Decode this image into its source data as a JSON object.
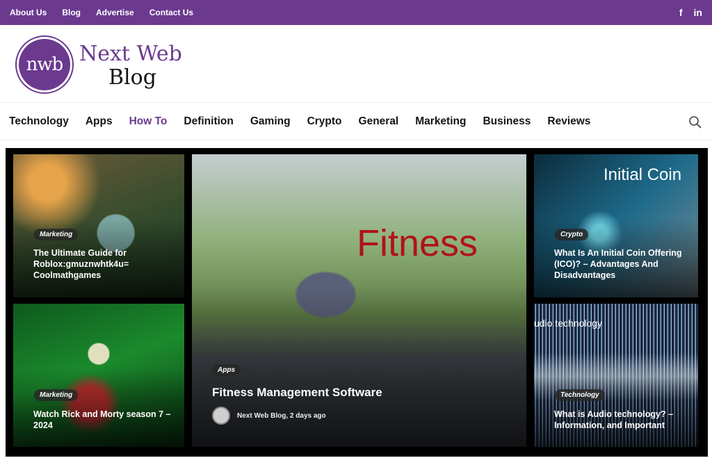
{
  "topbar": {
    "links": [
      "About Us",
      "Blog",
      "Advertise",
      "Contact Us"
    ],
    "social": [
      {
        "icon": "facebook-icon",
        "glyph": "f"
      },
      {
        "icon": "linkedin-icon",
        "glyph": "in"
      }
    ]
  },
  "logo": {
    "mark": "nwb",
    "line1": "Next Web",
    "line2": "Blog"
  },
  "nav": {
    "items": [
      "Technology",
      "Apps",
      "How To",
      "Definition",
      "Gaming",
      "Crypto",
      "General",
      "Marketing",
      "Business",
      "Reviews"
    ],
    "active": "How To"
  },
  "cards": [
    {
      "category": "Marketing",
      "title": "The Ultimate Guide for Roblox:gmuznwhtk4u= Coolmathgames"
    },
    {
      "category": "Marketing",
      "title": "Watch Rick and Morty season 7 – 2024"
    },
    {
      "category": "Apps",
      "title": "Fitness Management Software",
      "meta": "Next Web Blog, 2 days ago",
      "image_text": "Fitness"
    },
    {
      "category": "Crypto",
      "title": "What Is An Initial Coin Offering (ICO)? – Advantages And Disadvantages",
      "image_text": "Initial Coin"
    },
    {
      "category": "Technology",
      "title": "What is Audio technology? – Information, and Important",
      "image_text": "udio technology"
    }
  ],
  "colors": {
    "brand": "#6b3a8f",
    "fitness_text": "#b1121b"
  }
}
